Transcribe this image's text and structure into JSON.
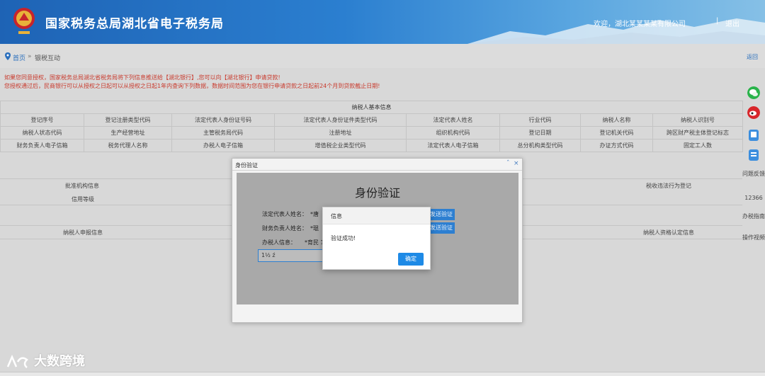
{
  "header": {
    "title": "国家税务总局湖北省电子税务局",
    "welcome": "欢迎，湖北某某某某有限公司",
    "separator": "|",
    "logout": "退出"
  },
  "breadcrumb": {
    "home": "首页",
    "arrow": "»",
    "current": "银税互动",
    "back": "返回"
  },
  "notices": [
    "如果您同意授权，国家税务总局湖北省税务局将下列信息推送给【湖北银行】,您可以向【湖北银行】申请贷款!",
    "您授权通过后，民商银行可以从授权之日起可以从授权之日起1年内查询下列数据，数据时间范围为您在银行申请贷款之日起前24个月到贷款截止日期!"
  ],
  "basic_info": {
    "title": "纳税人基本信息",
    "rows": [
      [
        "登记序号",
        "登记注册类型代码",
        "法定代表人身份证号码",
        "法定代表人身份证件类型代码",
        "法定代表人姓名",
        "行业代码",
        "纳税人名称",
        "纳税人识别号"
      ],
      [
        "纳税人状态代码",
        "生产经营地址",
        "主管税务局代码",
        "注册地址",
        "组织机构代码",
        "登记日期",
        "登记机关代码",
        "跨区财产税主体登记标志"
      ],
      [
        "财务负责人电子信箱",
        "税务代理人名称",
        "办税人电子信箱",
        "增值税企业类型代码",
        "法定代表人电子信箱",
        "总分机构类型代码",
        "办证方式代码",
        "固定工人数"
      ]
    ]
  },
  "sections": {
    "approval_org": "批准机构信息",
    "tax_violation": "税收违法行为登记",
    "credit_level": "信用等级",
    "declaration": "纳税人申报信息",
    "qualification": "纳税人资格认定信息"
  },
  "right_bar": {
    "feedback": "问题反馈",
    "hotline": "12366",
    "guide": "办税指南",
    "tutorial": "操作视频"
  },
  "identity_dialog": {
    "window_title": "身份验证",
    "minimize": "ˆ",
    "close": "×",
    "heading": "身份验证",
    "legal_rep_label": "法定代表人姓名：",
    "legal_rep_value": "*唐",
    "finance_label": "财务负责人姓名：",
    "finance_value": "*琨",
    "agent_label": "办税人信息：",
    "agent_value": "*育民 1",
    "send_code_1": "发送验证码",
    "send_code_2": "发送验证码",
    "phone_input": "1½  ź"
  },
  "message_box": {
    "title": "信息",
    "text": "验证成功!",
    "ok": "确定"
  },
  "watermark": {
    "brand": "大数跨境"
  }
}
